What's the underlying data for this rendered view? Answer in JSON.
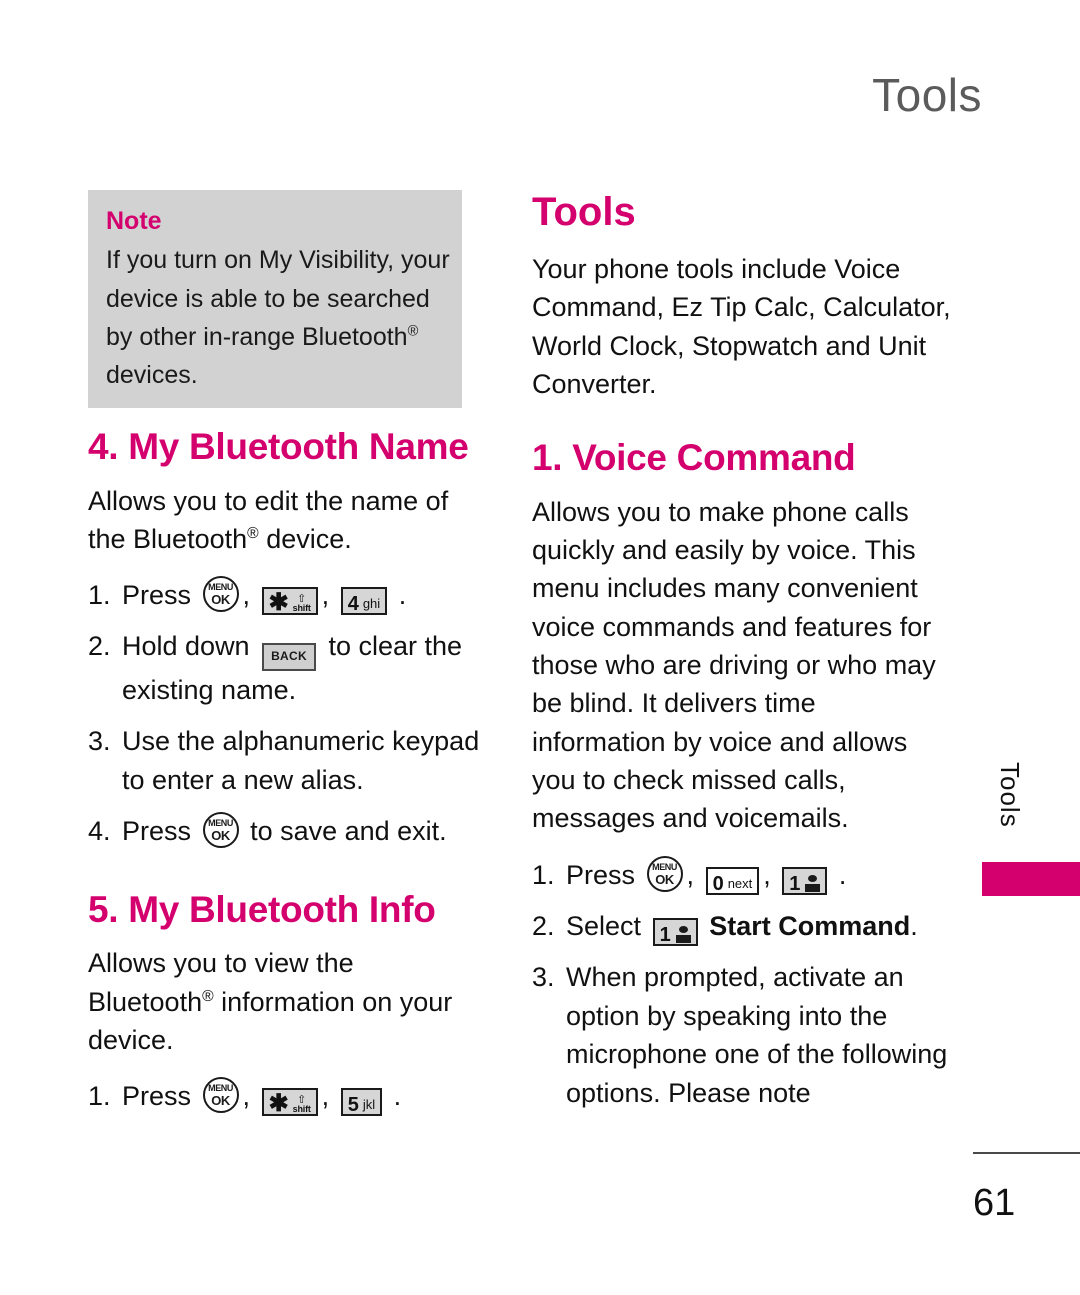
{
  "header": {
    "title": "Tools"
  },
  "side_tab": {
    "label": "Tools"
  },
  "footer": {
    "page_number": "61"
  },
  "colors": {
    "accent": "#d4006e",
    "header_gray": "#5b5b5b",
    "note_bg": "#d2d2d2",
    "key_bg": "#d6d6d6"
  },
  "left_column": {
    "note": {
      "title": "Note",
      "body": "If you turn on My Visibility, your device is able to be searched by other in-range Bluetooth® devices."
    },
    "section_bluetooth_name": {
      "heading": "4. My Bluetooth Name",
      "body": "Allows you to edit the name of the Bluetooth® device.",
      "steps": [
        {
          "num": "1.",
          "prefix": "Press",
          "keys": [
            "menu-ok-key",
            "star-shift-key",
            "4-ghi-key"
          ],
          "suffix": "."
        },
        {
          "num": "2.",
          "prefix": "Hold down",
          "keys": [
            "back-key"
          ],
          "suffix": "to clear the existing name."
        },
        {
          "num": "3.",
          "prefix": "Use the alphanumeric keypad to enter a new alias.",
          "keys": [],
          "suffix": ""
        },
        {
          "num": "4.",
          "prefix": "Press",
          "keys": [
            "menu-ok-key"
          ],
          "suffix": "to save and exit."
        }
      ]
    },
    "section_bluetooth_info": {
      "heading": "5. My Bluetooth Info",
      "body": "Allows you to view the Bluetooth® information on your device.",
      "steps": [
        {
          "num": "1.",
          "prefix": "Press",
          "keys": [
            "menu-ok-key",
            "star-shift-key",
            "5-jkl-key"
          ],
          "suffix": "."
        }
      ]
    }
  },
  "right_column": {
    "section_tools": {
      "heading": "Tools",
      "body": "Your phone tools include Voice Command, Ez Tip Calc, Calculator, World Clock, Stopwatch and Unit Converter."
    },
    "section_voice_command": {
      "heading": "1. Voice Command",
      "body": "Allows you to make phone calls quickly and easily by voice. This menu includes many convenient voice commands and features for those who are driving or who may be blind. It delivers time information by voice and allows you to check missed calls, messages and voicemails.",
      "steps": [
        {
          "num": "1.",
          "prefix": "Press",
          "keys": [
            "menu-ok-key",
            "0-next-key",
            "1-voicemail-key"
          ],
          "suffix": "."
        },
        {
          "num": "2.",
          "prefix": "Select",
          "keys": [
            "1-voicemail-key"
          ],
          "suffix_bold": "Start Command",
          "suffix": "."
        },
        {
          "num": "3.",
          "prefix": "When prompted, activate an option by speaking into the microphone one of the following options. Please note",
          "keys": [],
          "suffix": ""
        }
      ]
    }
  },
  "key_glyphs": {
    "menu_ok": {
      "top": "MENU",
      "bottom": "OK"
    },
    "star_shift": {
      "symbol": "✱",
      "label": "shift"
    },
    "four_ghi": {
      "digit": "4",
      "label": "ghi"
    },
    "five_jkl": {
      "digit": "5",
      "label": "jkl"
    },
    "zero_next": {
      "digit": "0",
      "label": "next"
    },
    "one_voicemail": {
      "digit": "1",
      "label": ""
    },
    "back": {
      "label": "BACK"
    }
  }
}
